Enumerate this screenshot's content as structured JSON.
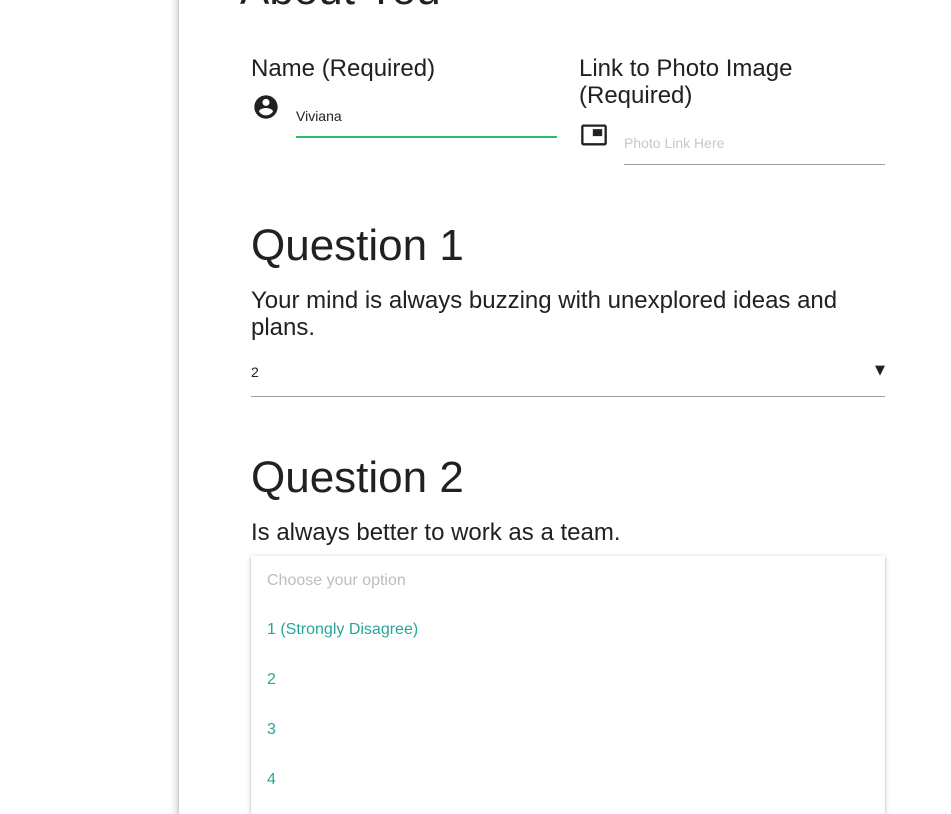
{
  "section": {
    "title": "About You"
  },
  "about_you": {
    "name_label": "Name (Required)",
    "name_icon": "account-circle-icon",
    "name_value": "Viviana",
    "photo_label": "Link to Photo Image (Required)",
    "photo_icon": "picture-in-picture-icon",
    "photo_placeholder": "Photo Link Here",
    "photo_value": ""
  },
  "questions": [
    {
      "title": "Question 1",
      "text": "Your mind is always buzzing with unexplored ideas and plans.",
      "selected": "2",
      "caret_icon": "caret-down-icon"
    },
    {
      "title": "Question 2",
      "text": "Is always better to work as a team.",
      "dropdown": {
        "placeholder": "Choose your option",
        "options": [
          "1 (Strongly Disagree)",
          "2",
          "3",
          "4"
        ]
      }
    }
  ],
  "colors": {
    "accent_teal": "#26a69a",
    "active_underline": "#2bbd68",
    "text": "#212121",
    "placeholder": "#c7c7c7"
  }
}
